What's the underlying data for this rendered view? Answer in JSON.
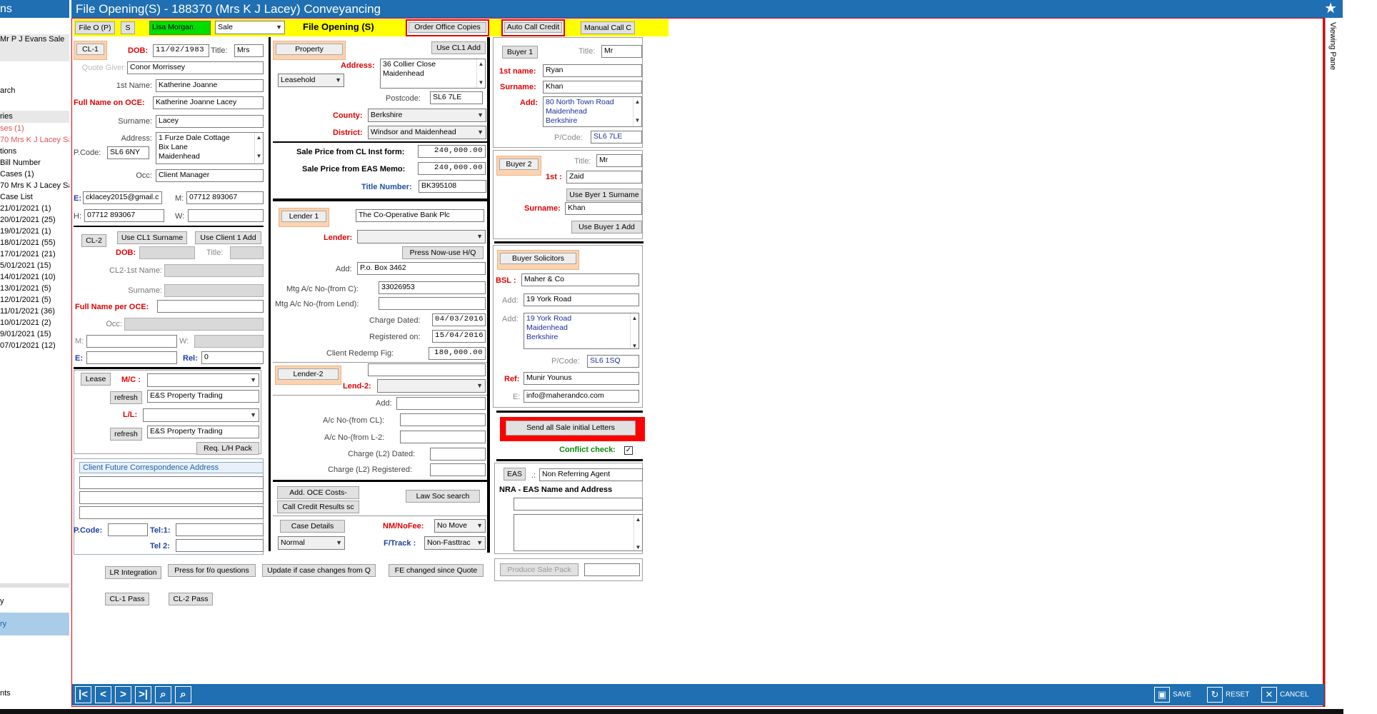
{
  "window": {
    "title": "File Opening(S) - 188370 (Mrs K J Lacey) Conveyancing"
  },
  "sidebar": {
    "header": "ns",
    "items": [
      "Mr P J Evans Sale",
      "arch",
      "ries",
      "ses  (1)",
      "70 Mrs K J Lacey Sa",
      "tions",
      "Bill Number",
      "Cases  (1)",
      "70 Mrs K J Lacey Sa",
      "Case List",
      "21/01/2021  (1)",
      "20/01/2021  (25)",
      "19/01/2021  (1)",
      "18/01/2021  (55)",
      "17/01/2021  (21)",
      "5/01/2021  (15)",
      "14/01/2021  (10)",
      "13/01/2021  (5)",
      "12/01/2021  (5)",
      "11/01/2021  (36)",
      "10/01/2021  (2)",
      "9/01/2021  (15)",
      "07/01/2021  (12)",
      ".........",
      "y",
      "ry",
      "nts"
    ]
  },
  "toolbar": {
    "file_o": "File O (P)",
    "s": "S",
    "user": "Lisa Morgan",
    "type": "Sale",
    "heading": "File Opening (S)",
    "order_office": "Order Office Copies",
    "auto_call": "Auto Call Credit",
    "manual_call": "Manual Call C"
  },
  "viewing_pane": "Viewing Pane",
  "client": {
    "cl1_btn": "CL-1",
    "dob_label": "DOB:",
    "dob": "11/02/1983",
    "title_label": "Title:",
    "title": "Mrs",
    "quote_giver_label": "Quote Giver:",
    "quote_giver": "Conor Morrissey",
    "first_name_label": "1st Name:",
    "first_name": "Katherine Joanne",
    "full_name_label": "Full Name on OCE:",
    "full_name": "Katherine Joanne Lacey",
    "surname_label": "Surname:",
    "surname": "Lacey",
    "address_label": "Address:",
    "address": [
      "1 Furze Dale Cottage",
      "Bix Lane",
      "Maidenhead"
    ],
    "pcode_label": "P.Code:",
    "pcode": "SL6 6NY",
    "occ_label": "Occ:",
    "occ": "Client Manager",
    "e_label": "E:",
    "email": "cklacey2015@gmail.c",
    "m_label": "M:",
    "mobile": "07712 893067",
    "h_label": "H:",
    "home": "07712 893067",
    "w_label": "W:",
    "cl2_btn": "CL-2",
    "use_cl1_surname": "Use CL1 Surname",
    "use_client1_add": "Use Client 1 Add",
    "dob2_label": "DOB:",
    "title2_label": "Title:",
    "cl2_first_label": "CL2-1st Name:",
    "surname2_label": "Surname:",
    "full_name2_label": "Full Name per OCE:",
    "occ2_label": "Occ:",
    "m2_label": "M:",
    "w2_label": "W:",
    "e2_label": "E:",
    "rel_label": "Rel:",
    "rel": "0"
  },
  "lease": {
    "lease_btn": "Lease",
    "mc_label": "M/C :",
    "refresh1": "refresh",
    "mc_value": "E&S Property Trading",
    "ll_label": "L/L:",
    "refresh2": "refresh",
    "ll_value": "E&S Property Trading",
    "req_lh": "Req. L/H Pack"
  },
  "future_corr": {
    "header": "Client Future Correspondence Address",
    "pcode_label": "P.Code:",
    "tel1_label": "Tel:1:",
    "tel2_label": "Tel 2:"
  },
  "bottom_buttons": {
    "lr": "LR Integration",
    "fo": "Press for f/o questions",
    "update": "Update if case changes from Q",
    "fe": "FE changed since Quote",
    "cl1pass": "CL-1 Pass",
    "cl2pass": "CL-2 Pass",
    "produce": "Produce Sale Pack"
  },
  "property": {
    "btn": "Property",
    "use_cl1_add": "Use CL1 Add",
    "address_label": "Address:",
    "address": [
      "36 Collier Close",
      "Maidenhead"
    ],
    "tenure": "Leasehold",
    "postcode_label": "Postcode:",
    "postcode": "SL6 7LE",
    "county_label": "County:",
    "county": "Berkshire",
    "district_label": "District:",
    "district": "Windsor and Maidenhead",
    "sale_cl_label": "Sale Price from CL Inst form:",
    "sale_cl": "240,000.00",
    "sale_eas_label": "Sale Price from EAS Memo:",
    "sale_eas": "240,000.00",
    "title_no_label": "Title Number:",
    "title_no": "BK395108"
  },
  "lender": {
    "btn1": "Lender 1",
    "lender1_name": "The Co-Operative Bank Plc",
    "lender_label": "Lender:",
    "press_now": "Press Now-use H/Q",
    "add_label": "Add:",
    "add": "P.o. Box 3462",
    "mtg_c_label": "Mtg  A/c No-(from C):",
    "mtg_c": "33026953",
    "mtg_lend_label": "Mtg A/c No-(from Lend):",
    "charge_dated_label": "Charge Dated:",
    "charge_dated": "04/03/2016",
    "registered_label": "Registered on:",
    "registered": "15/04/2016",
    "redemp_label": "Client Redemp Fig:",
    "redemp": "180,000.00",
    "btn2": "Lender-2",
    "lend2_label": "Lend-2:",
    "add2_label": "Add:",
    "ac_cl_label": "A/c No-(from CL):",
    "ac_l2_label": "A/c No-(from L-2:",
    "charge_l2_label": "Charge (L2) Dated:",
    "charge_l2_reg_label": "Charge (L2) Registered:"
  },
  "misc": {
    "add_oce": "Add. OCE Costs-",
    "law_soc": "Law Soc search",
    "call_credit": "Call Credit Results sc",
    "case_details": "Case Details",
    "nm_label": "NM/NoFee:",
    "nm_value": "No Move",
    "normal": "Normal",
    "ftrack_label": "F/Track :",
    "ftrack_value": "Non-Fasttrac"
  },
  "buyer": {
    "b1_btn": "Buyer 1",
    "title_label": "Title:",
    "title": "Mr",
    "first_label": "1st name:",
    "first": "Ryan",
    "surname_label": "Surname:",
    "surname": "Khan",
    "add_label": "Add:",
    "add": [
      "80 North Town Road",
      "Maidenhead",
      "Berkshire"
    ],
    "pcode_label": "P/Code:",
    "pcode": "SL6 7LE",
    "b2_btn": "Buyer 2",
    "title2_label": "Title:",
    "title2": "Mr",
    "first2_label": "1st :",
    "first2": "Zaid",
    "use_b1_surname": "Use Byer 1 Surname",
    "surname2_label": "Surname:",
    "surname2": "Khan",
    "use_b1_add": "Use Buyer 1 Add"
  },
  "solicitor": {
    "btn": "Buyer Solicitors",
    "bsl_label": "BSL :",
    "bsl": "Maher & Co",
    "add_label": "Add:",
    "add": "19 York Road",
    "add2_label": "Add:",
    "full_add": [
      "19 York Road",
      "Maidenhead",
      "Berkshire"
    ],
    "pcode_label": "P/Code:",
    "pcode": "SL6 1SQ",
    "ref_label": "Ref:",
    "ref": "Munir Younus",
    "e_label": "E:",
    "email": "info@maherandco.com",
    "send_letters": "Send all Sale initial Letters",
    "conflict_label": "Conflict check:",
    "conflict_checked": true
  },
  "eas": {
    "btn": "EAS",
    "sep": ".:",
    "value": "Non Referring Agent",
    "nra_label": "NRA - EAS Name and Address"
  },
  "footer": {
    "save": "SAVE",
    "reset": "RESET",
    "cancel": "CANCEL"
  }
}
